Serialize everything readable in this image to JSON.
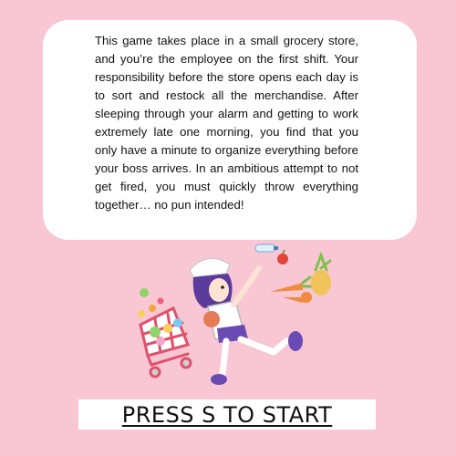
{
  "intro": {
    "story": "This game takes place in a small grocery store, and you’re the employee on the first shift. Your responsibility before the store opens each day is to sort and restock all the merchandise. After sleeping through your alarm and getting to work extremely late one morning, you find that you only have a minute to organize everything before your boss arrives. In an ambitious attempt to not get fired, you must quickly throw everything together… no pun intended!"
  },
  "start_prompt": {
    "label": "PRESS S TO START",
    "key": "S"
  },
  "illustration": {
    "subject": "grocery clerk running with a cart, throwing items",
    "icons": [
      "shopping-cart-icon",
      "character-icon",
      "bottle-icon",
      "apple-icon",
      "carrot-icon",
      "pineapple-icon"
    ],
    "colors": {
      "background": "#f9c6d4",
      "hair": "#5b3a9c",
      "shoes": "#6a4bb3",
      "skin": "#fde3d2",
      "carrot": "#f08a3e",
      "leaves": "#7cc24a",
      "apple": "#e2443a",
      "cart": "#e1506b"
    }
  }
}
